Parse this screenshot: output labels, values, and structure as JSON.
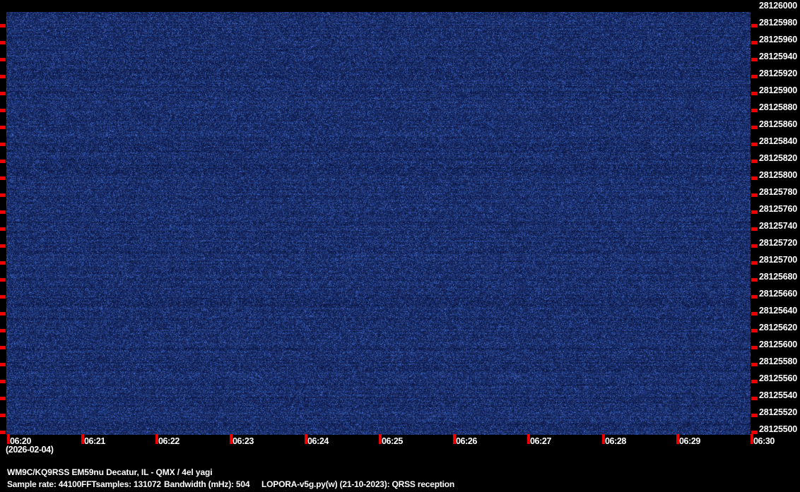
{
  "colors": {
    "background": "#000000",
    "tick_red": "#ee0000",
    "text_white": "#ffffff",
    "noise_base": "#08113a",
    "noise_peak": "#5084f8"
  },
  "chart_data": {
    "type": "heatmap",
    "title": "",
    "x_ticks": [
      "06:20",
      "06:21",
      "06:22",
      "06:23",
      "06:24",
      "06:25",
      "06:26",
      "06:27",
      "06:28",
      "06:29",
      "06:30"
    ],
    "y_ticks": [
      "28126000",
      "28125980",
      "28125960",
      "28125940",
      "28125920",
      "28125900",
      "28125880",
      "28125860",
      "28125840",
      "28125820",
      "28125800",
      "28125780",
      "28125760",
      "28125740",
      "28125720",
      "28125700",
      "28125680",
      "28125660",
      "28125640",
      "28125620",
      "28125600",
      "28125580",
      "28125560",
      "28125540",
      "28125520",
      "28125500"
    ],
    "x_range": [
      "06:20",
      "06:30"
    ],
    "y_range_hz": [
      28125500,
      28126000
    ],
    "grid": false,
    "legend": false,
    "content": "uniform dark-blue receiver noise floor; no visible signal traces"
  },
  "x_axis": {
    "date": "(2026-02-04)"
  },
  "footer": {
    "station_line": "WM9C/KQ9RSS EM59nu Decatur, IL - QMX / 4el yagi",
    "sample_rate": "Sample rate: 44100",
    "fft_samples": "FFTsamples: 131072",
    "bandwidth": "Bandwidth (mHz): 504",
    "software": "LOPORA-v5g.py(w) (21-10-2023): QRSS reception"
  }
}
